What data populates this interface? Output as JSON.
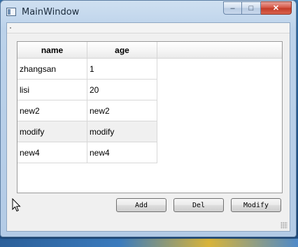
{
  "window": {
    "title": "MainWindow",
    "minimize_glyph": "–",
    "maximize_glyph": "□",
    "close_glyph": "✕"
  },
  "table": {
    "columns": [
      "name",
      "age"
    ],
    "rows": [
      {
        "name": "zhangsan",
        "age": "1"
      },
      {
        "name": "lisi",
        "age": "20"
      },
      {
        "name": "new2",
        "age": "new2"
      },
      {
        "name": "modify",
        "age": "modify"
      },
      {
        "name": "new4",
        "age": "new4"
      }
    ],
    "selected_row_index": 3
  },
  "buttons": {
    "add": "Add",
    "del": "Del",
    "modify": "Modify"
  },
  "colors": {
    "close_button": "#c23a26",
    "title_bar": "#bcd2ea",
    "selected_row": "#f0f0f0"
  }
}
